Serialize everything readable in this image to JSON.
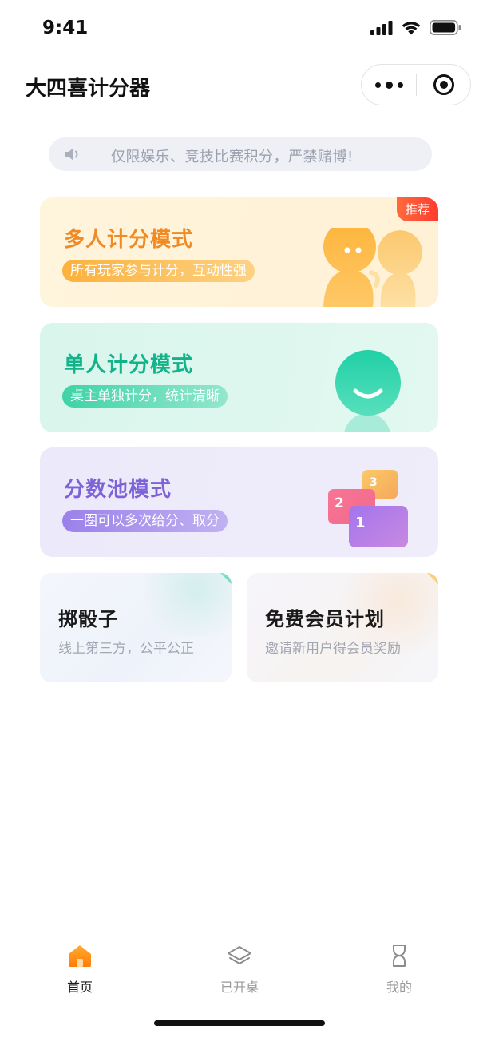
{
  "status_bar": {
    "time": "9:41"
  },
  "header": {
    "title": "大四喜计分器"
  },
  "notice": {
    "text": "仅限娱乐、竞技比赛积分，严禁赌博!"
  },
  "modes": [
    {
      "title": "多人计分模式",
      "subtitle": "所有玩家参与计分，互动性强",
      "badge": "推荐",
      "color": "#f08a24"
    },
    {
      "title": "单人计分模式",
      "subtitle": "桌主单独计分，统计清晰",
      "color": "#13b38a"
    },
    {
      "title": "分数池模式",
      "subtitle": "一圈可以多次给分、取分",
      "color": "#7d63d8",
      "chips": [
        "3",
        "2",
        "1"
      ]
    }
  ],
  "shortcuts": [
    {
      "title": "掷骰子",
      "subtitle": "线上第三方，公平公正"
    },
    {
      "title": "免费会员计划",
      "subtitle": "邀请新用户得会员奖励"
    }
  ],
  "tabbar": {
    "items": [
      {
        "label": "首页",
        "icon": "home-icon",
        "active": true
      },
      {
        "label": "已开桌",
        "icon": "layers-icon",
        "active": false
      },
      {
        "label": "我的",
        "icon": "profile-icon",
        "active": false
      }
    ]
  },
  "colors": {
    "accent": "#ff8a00",
    "badge": "#ff3b2f"
  }
}
